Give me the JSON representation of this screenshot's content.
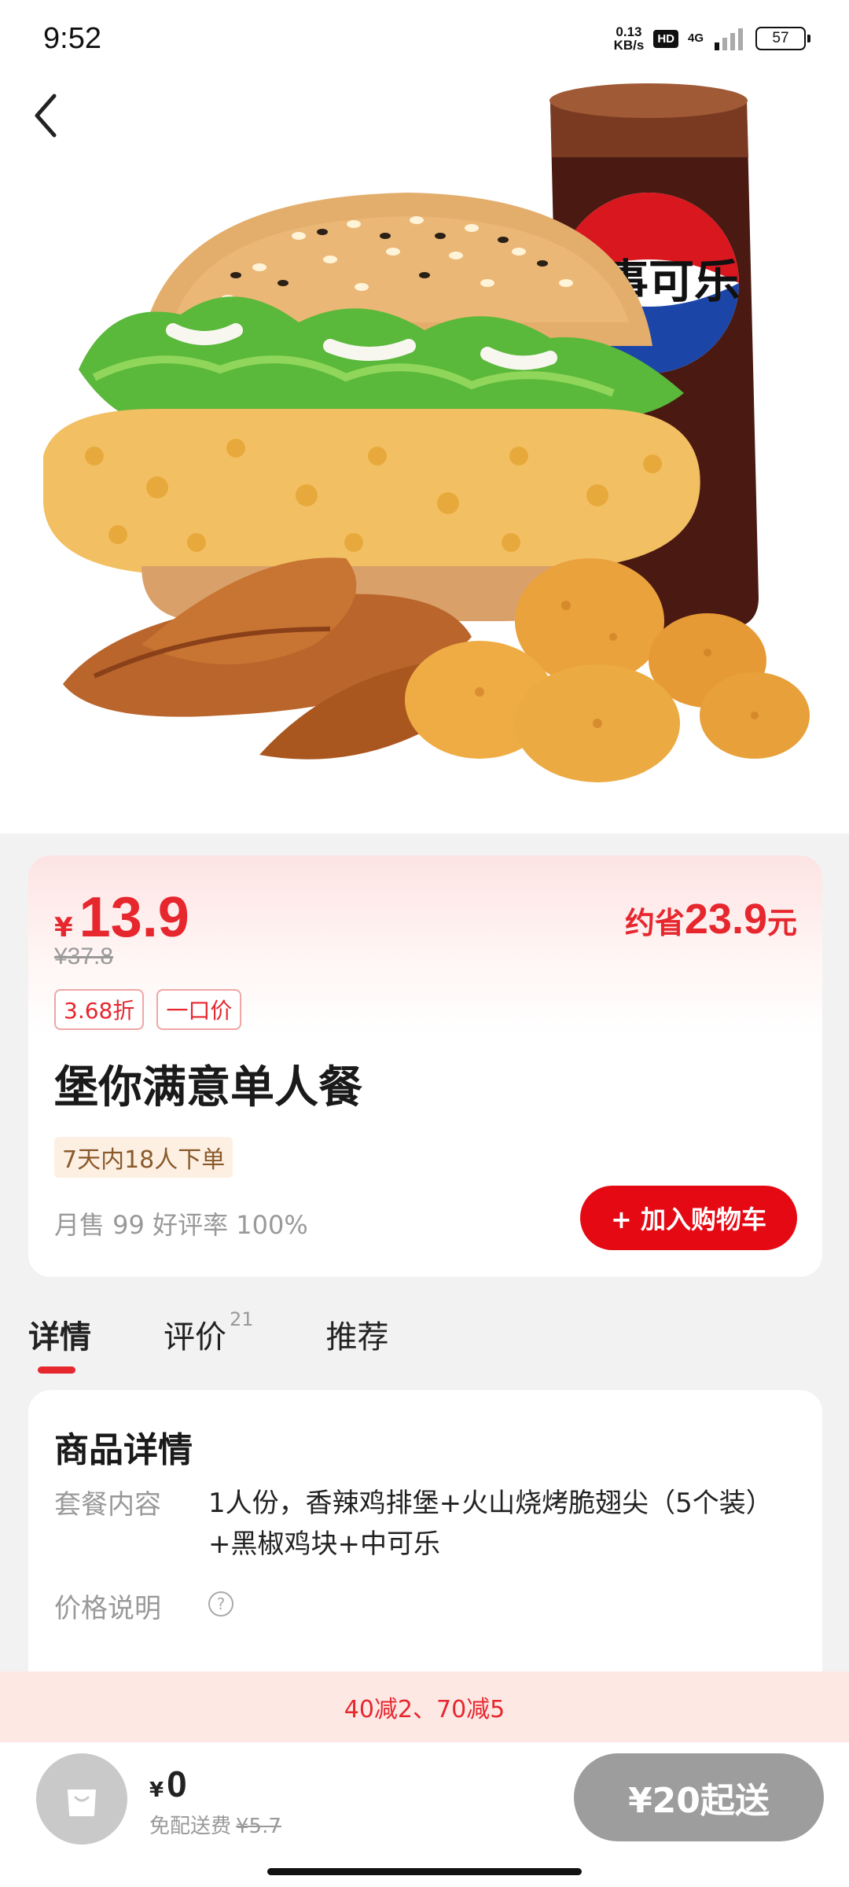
{
  "status_bar": {
    "time": "9:52",
    "speed_value": "0.13",
    "speed_unit": "KB/s",
    "hd": "HD",
    "network": "4G",
    "battery": "57"
  },
  "hero": {
    "cup_text": "百事可乐"
  },
  "product": {
    "currency": "¥",
    "price": "13.9",
    "original_price": "¥37.8",
    "save_prefix": "约省",
    "save_amount": "23.9",
    "save_unit": "元",
    "tags": [
      "3.68折",
      "一口价"
    ],
    "title": "堡你满意单人餐",
    "orders_badge": "7天内18人下单",
    "monthly_stats": "月售 99 好评率 100%",
    "add_to_cart": "+ 加入购物车"
  },
  "tabs": [
    {
      "label": "详情",
      "count": ""
    },
    {
      "label": "评价",
      "count": "21"
    },
    {
      "label": "推荐",
      "count": ""
    }
  ],
  "details": {
    "title": "商品详情",
    "content_label": "套餐内容",
    "content_value": "1人份，香辣鸡排堡+火山烧烤脆翅尖（5个装）+黑椒鸡块+中可乐",
    "price_label": "价格说明",
    "help_icon": "?"
  },
  "promo": {
    "text": "40减2、70减5"
  },
  "bottom_bar": {
    "currency": "¥",
    "total": "0",
    "free_delivery": "免配送费",
    "delivery_fee": "¥5.7",
    "checkout": "¥20起送"
  },
  "colors": {
    "accent": "#e6272e",
    "button_red": "#e50914",
    "checkout_gray": "#9d9d9d"
  }
}
